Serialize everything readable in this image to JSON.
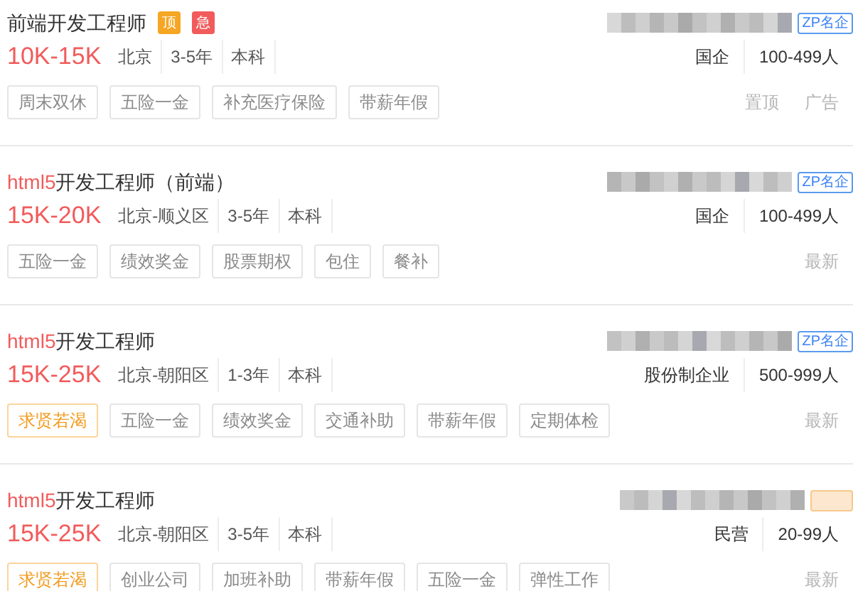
{
  "jobs": [
    {
      "title": "前端开发工程师",
      "flags": [
        {
          "text": "顶",
          "color": "#f5a623"
        },
        {
          "text": "急",
          "color": "#f25b5b"
        }
      ],
      "salary": "10K-15K",
      "meta": [
        "北京",
        "3-5年",
        "本科"
      ],
      "badge": "ZP名企",
      "company_info": [
        "国企",
        "100-499人"
      ],
      "tags": [
        {
          "text": "周末双休",
          "kind": "normal"
        },
        {
          "text": "五险一金",
          "kind": "normal"
        },
        {
          "text": "补充医疗保险",
          "kind": "normal"
        },
        {
          "text": "带薪年假",
          "kind": "normal"
        }
      ],
      "notes": [
        "置顶",
        "广告"
      ]
    },
    {
      "keyword": "html5",
      "title": "开发工程师（前端）",
      "salary": "15K-20K",
      "meta": [
        "北京-顺义区",
        "3-5年",
        "本科"
      ],
      "badge": "ZP名企",
      "company_info": [
        "国企",
        "100-499人"
      ],
      "tags": [
        {
          "text": "五险一金",
          "kind": "normal"
        },
        {
          "text": "绩效奖金",
          "kind": "normal"
        },
        {
          "text": "股票期权",
          "kind": "normal"
        },
        {
          "text": "包住",
          "kind": "normal"
        },
        {
          "text": "餐补",
          "kind": "normal"
        }
      ],
      "notes": [
        "最新"
      ]
    },
    {
      "keyword": "html5",
      "title": "开发工程师",
      "salary": "15K-25K",
      "meta": [
        "北京-朝阳区",
        "1-3年",
        "本科"
      ],
      "badge": "ZP名企",
      "company_info": [
        "股份制企业",
        "500-999人"
      ],
      "tags": [
        {
          "text": "求贤若渴",
          "kind": "highlight"
        },
        {
          "text": "五险一金",
          "kind": "normal"
        },
        {
          "text": "绩效奖金",
          "kind": "normal"
        },
        {
          "text": "交通补助",
          "kind": "normal"
        },
        {
          "text": "带薪年假",
          "kind": "normal"
        },
        {
          "text": "定期体检",
          "kind": "normal"
        }
      ],
      "notes": [
        "最新"
      ]
    },
    {
      "keyword": "html5",
      "title": "开发工程师",
      "salary": "15K-25K",
      "meta": [
        "北京-朝阳区",
        "3-5年",
        "本科"
      ],
      "company_info": [
        "民营",
        "20-99人"
      ],
      "tags": [
        {
          "text": "求贤若渴",
          "kind": "highlight"
        },
        {
          "text": "创业公司",
          "kind": "normal"
        },
        {
          "text": "加班补助",
          "kind": "normal"
        },
        {
          "text": "带薪年假",
          "kind": "normal"
        },
        {
          "text": "五险一金",
          "kind": "normal"
        },
        {
          "text": "弹性工作",
          "kind": "normal"
        }
      ],
      "notes": [
        "最新"
      ]
    }
  ]
}
